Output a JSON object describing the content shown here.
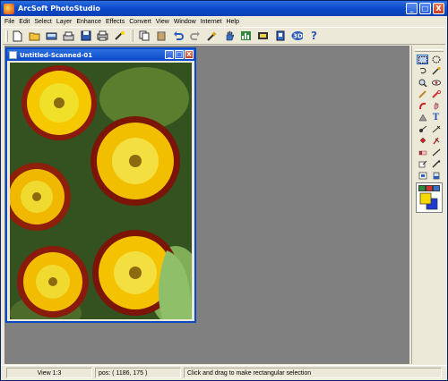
{
  "app": {
    "title": "ArcSoft PhotoStudio"
  },
  "window_buttons": {
    "minimize": "_",
    "maximize": "□",
    "close": "X"
  },
  "menu": [
    "File",
    "Edit",
    "Select",
    "Layer",
    "Enhance",
    "Effects",
    "Convert",
    "View",
    "Window",
    "Internet",
    "Help"
  ],
  "toolbar": {
    "icons": [
      "new-icon",
      "open-icon",
      "acquire-icon",
      "print-preview-icon",
      "save-icon",
      "print-icon",
      "magic-icon",
      "copy-icon",
      "paste-icon",
      "undo-icon",
      "redo-icon",
      "auto-enhance-icon",
      "hand-icon",
      "levels-icon",
      "slideshow-icon",
      "album-icon",
      "3d-icon",
      "help-icon"
    ],
    "help_glyph": "?",
    "three_d_glyph": "3D"
  },
  "document": {
    "title": "Untitled-Scanned-01"
  },
  "palette": {
    "tools": [
      "rect-select-tool",
      "ellipse-select-tool",
      "lasso-tool",
      "magic-wand-tool",
      "zoom-tool",
      "eye-tool",
      "pen-tool",
      "red-eye-tool",
      "clone-tool",
      "smudge-tool",
      "blur-tool",
      "text-tool",
      "dodge-tool",
      "burn-tool",
      "fill-tool",
      "sharpen-tool",
      "eraser-tool",
      "line-tool",
      "color-picker-tool",
      "eyedropper-tool",
      "crop-tool",
      "fill-bucket-tool"
    ],
    "text_tool_glyph": "T",
    "colors": {
      "foreground": "#f5d800",
      "background": "#1e3bd1"
    }
  },
  "status": {
    "view": "View 1:3",
    "position": "pos: ( 1186, 175 )",
    "message": "Click and drag to make rectangular selection"
  }
}
